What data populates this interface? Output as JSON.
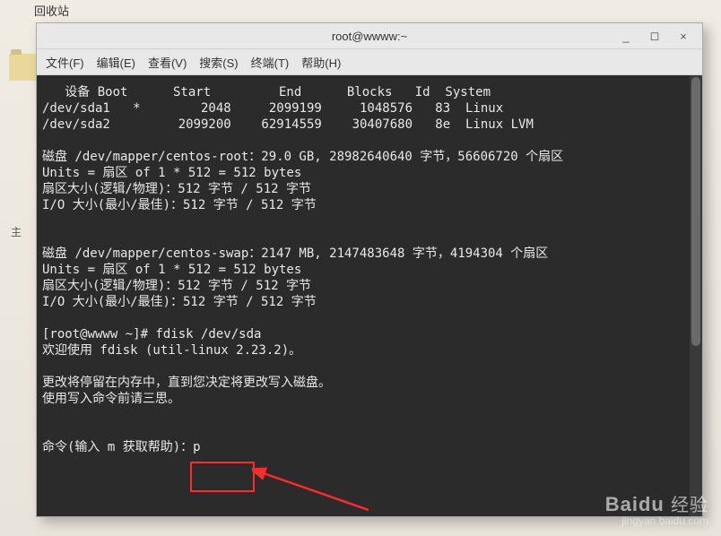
{
  "desktop": {
    "recycle_label": "回收站",
    "left_char": "主"
  },
  "window": {
    "title": "root@wwww:~",
    "buttons": {
      "min": "_",
      "max": "◻",
      "close": "×"
    }
  },
  "menubar": {
    "file": "文件(F)",
    "edit": "编辑(E)",
    "view": "查看(V)",
    "search": "搜索(S)",
    "terminal": "终端(T)",
    "help": "帮助(H)"
  },
  "terminal_text": "   设备 Boot      Start         End      Blocks   Id  System\n/dev/sda1   *        2048     2099199     1048576   83  Linux\n/dev/sda2         2099200    62914559    30407680   8e  Linux LVM\n\n磁盘 /dev/mapper/centos-root：29.0 GB, 28982640640 字节，56606720 个扇区\nUnits = 扇区 of 1 * 512 = 512 bytes\n扇区大小(逻辑/物理)：512 字节 / 512 字节\nI/O 大小(最小/最佳)：512 字节 / 512 字节\n\n\n磁盘 /dev/mapper/centos-swap：2147 MB, 2147483648 字节，4194304 个扇区\nUnits = 扇区 of 1 * 512 = 512 bytes\n扇区大小(逻辑/物理)：512 字节 / 512 字节\nI/O 大小(最小/最佳)：512 字节 / 512 字节\n\n[root@wwww ~]# fdisk /dev/sda\n欢迎使用 fdisk (util-linux 2.23.2)。\n\n更改将停留在内存中，直到您决定将更改写入磁盘。\n使用写入命令前请三思。\n\n\n命令(输入 m 获取帮助)：p",
  "watermark": {
    "brand_en": "Baidu",
    "brand_cn": "经验",
    "url": "jingyan.baidu.com"
  }
}
